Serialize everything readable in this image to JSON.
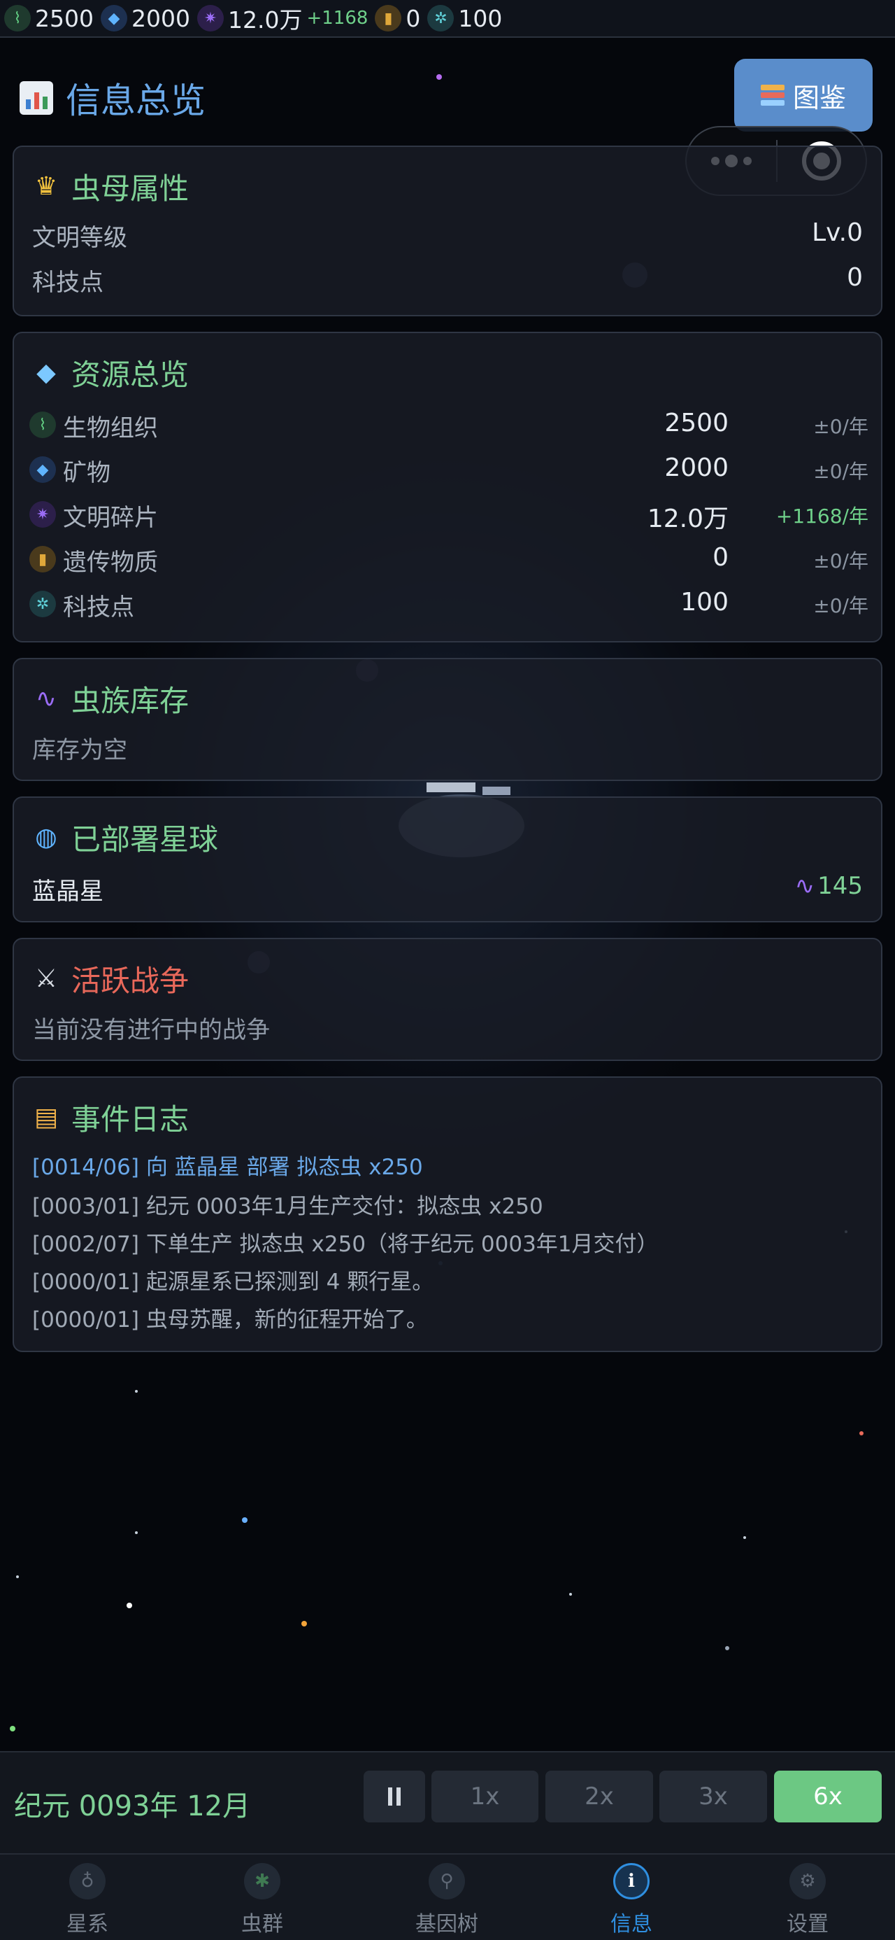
{
  "resource_bar": {
    "items": [
      {
        "icon": "dna-icon",
        "value": "2500"
      },
      {
        "icon": "gem-icon",
        "value": "2000"
      },
      {
        "icon": "civ-fragment-icon",
        "value": "12.0万",
        "delta": "+1168"
      },
      {
        "icon": "genetic-icon",
        "value": "0"
      },
      {
        "icon": "gear-icon",
        "value": "100"
      }
    ]
  },
  "header": {
    "title": "信息总览",
    "atlas_label": "图鉴"
  },
  "queen": {
    "title": "虫母属性",
    "rows": [
      {
        "label": "文明等级",
        "value": "Lv.0"
      },
      {
        "label": "科技点",
        "value": "0"
      }
    ]
  },
  "resources": {
    "title": "资源总览",
    "rows": [
      {
        "label": "生物组织",
        "value": "2500",
        "rate": "±0/年"
      },
      {
        "label": "矿物",
        "value": "2000",
        "rate": "±0/年"
      },
      {
        "label": "文明碎片",
        "value": "12.0万",
        "rate": "+1168/年"
      },
      {
        "label": "遗传物质",
        "value": "0",
        "rate": "±0/年"
      },
      {
        "label": "科技点",
        "value": "100",
        "rate": "±0/年"
      }
    ]
  },
  "inventory": {
    "title": "虫族库存",
    "empty_text": "库存为空"
  },
  "planets": {
    "title": "已部署星球",
    "items": [
      {
        "name": "蓝晶星",
        "units": "145"
      }
    ]
  },
  "wars": {
    "title": "活跃战争",
    "empty_text": "当前没有进行中的战争"
  },
  "events": {
    "title": "事件日志",
    "lines": [
      "[0014/06] 向 蓝晶星 部署 拟态虫 x250",
      "[0003/01] 纪元 0003年1月生产交付：拟态虫 x250",
      "[0002/07] 下单生产 拟态虫 x250（将于纪元 0003年1月交付）",
      "[0000/01] 起源星系已探测到 4 颗行星。",
      "[0000/01] 虫母苏醒，新的征程开始了。"
    ]
  },
  "timebar": {
    "era": "纪元 0093年 12月",
    "speeds": [
      "1x",
      "2x",
      "3x",
      "6x"
    ],
    "active_speed": "6x"
  },
  "nav": {
    "items": [
      {
        "label": "星系",
        "icon": "planet-icon"
      },
      {
        "label": "虫群",
        "icon": "bug-icon"
      },
      {
        "label": "基因树",
        "icon": "gene-tree-icon"
      },
      {
        "label": "信息",
        "icon": "info-icon"
      },
      {
        "label": "设置",
        "icon": "settings-icon"
      }
    ],
    "active": "信息"
  },
  "colors": {
    "accent_green": "#7fd196",
    "accent_blue": "#6aa8e8",
    "accent_red": "#e8685a",
    "active_nav": "#2f8fe0",
    "active_speed": "#6cc883"
  }
}
